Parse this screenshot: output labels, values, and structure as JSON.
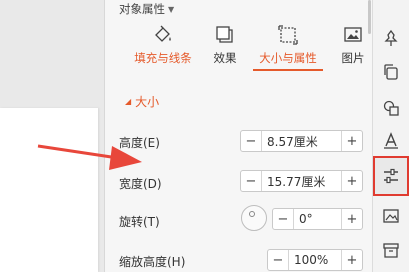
{
  "panel": {
    "title": "对象属性",
    "tabs": [
      {
        "label": "填充与线条",
        "icon": "fill-bucket-icon",
        "active": false
      },
      {
        "label": "效果",
        "icon": "effect-shape-icon",
        "active": false
      },
      {
        "label": "大小与属性",
        "icon": "size-frame-icon",
        "active": true
      },
      {
        "label": "图片",
        "icon": "picture-icon",
        "active": false
      }
    ],
    "section_title": "大小",
    "rows": {
      "height": {
        "label": "高度(E)",
        "value": "8.57厘米"
      },
      "width": {
        "label": "宽度(D)",
        "value": "15.77厘米"
      },
      "rotation": {
        "label": "旋转(T)",
        "value": "0°"
      },
      "scale_height": {
        "label": "缩放高度(H)",
        "value": "100%"
      }
    },
    "stepper_minus": "−",
    "stepper_plus": "+"
  },
  "sidebar": {
    "icons": [
      "pin-icon",
      "copy-icon",
      "shapes-icon",
      "text-style-icon",
      "properties-sliders-icon",
      "image-edit-icon",
      "archive-box-icon"
    ],
    "selected": "properties-sliders-icon"
  },
  "colors": {
    "accent": "#e55a2b",
    "highlight_border": "#e03b30",
    "arrow": "#e8473b"
  }
}
